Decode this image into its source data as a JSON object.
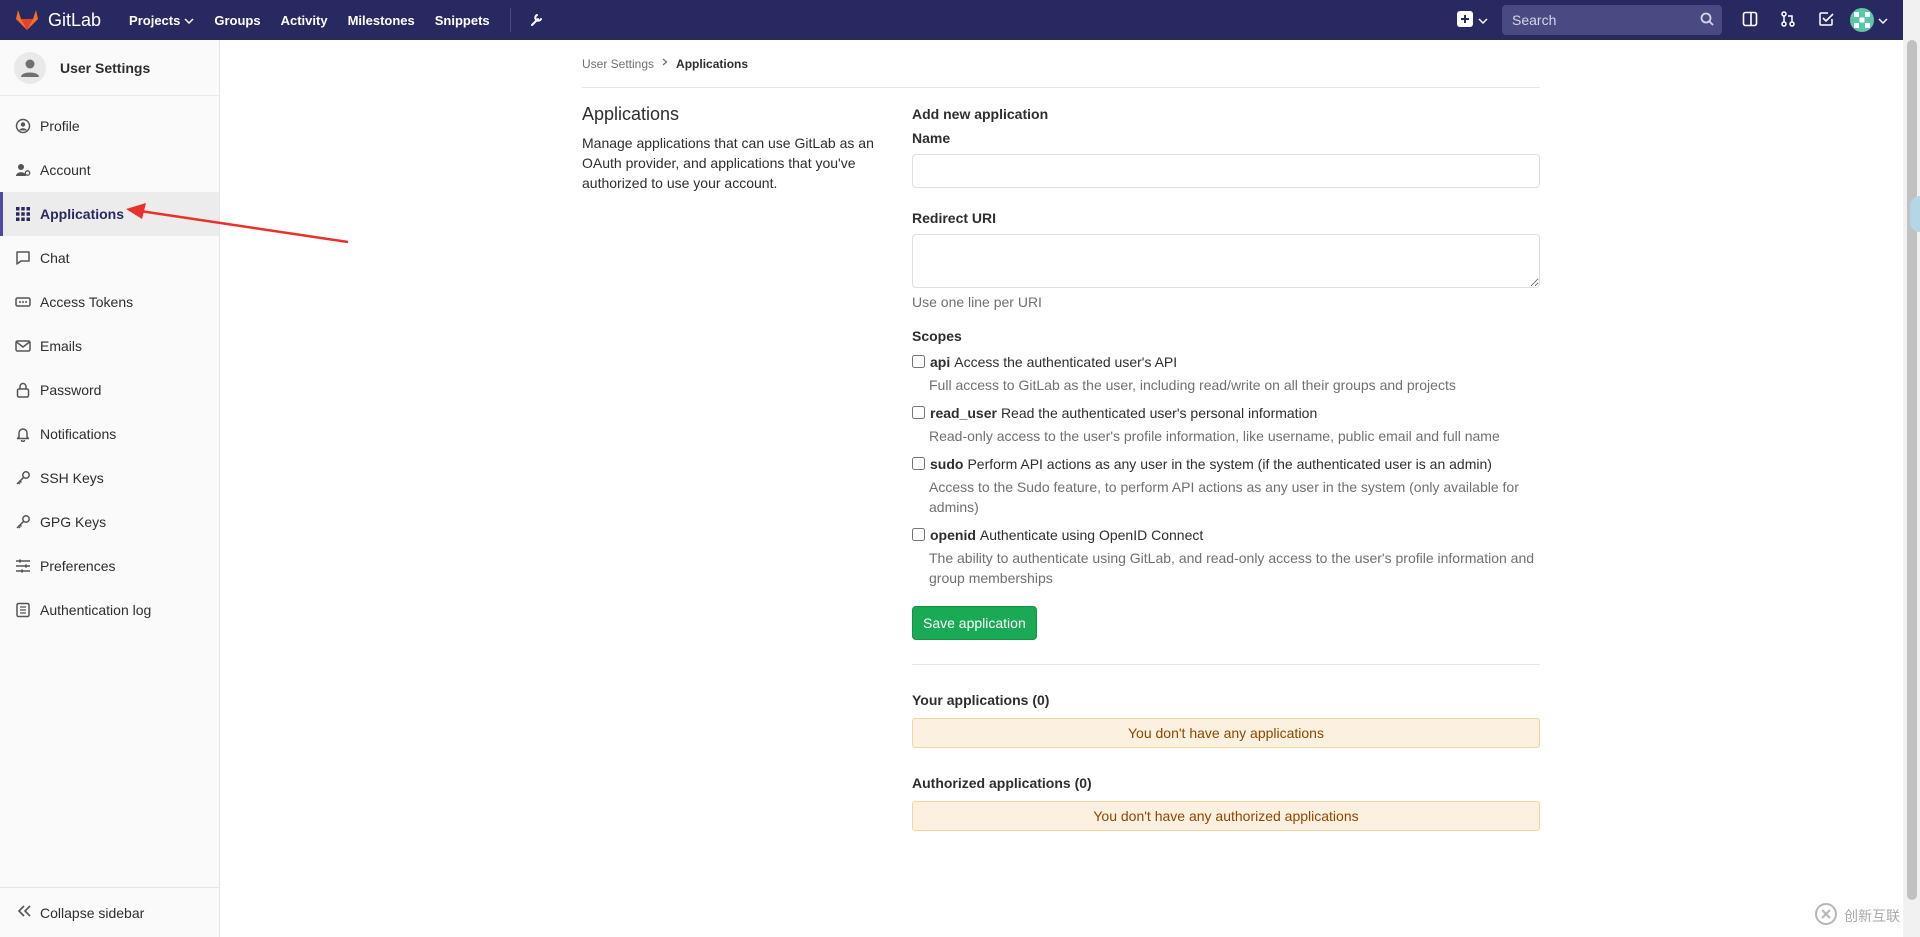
{
  "navbar": {
    "brand": "GitLab",
    "links": [
      {
        "label": "Projects",
        "has_caret": true
      },
      {
        "label": "Groups"
      },
      {
        "label": "Activity"
      },
      {
        "label": "Milestones"
      },
      {
        "label": "Snippets"
      }
    ],
    "search_placeholder": "Search"
  },
  "sidebar": {
    "title": "User Settings",
    "items": [
      {
        "label": "Profile",
        "icon": "profile-icon"
      },
      {
        "label": "Account",
        "icon": "account-icon"
      },
      {
        "label": "Applications",
        "icon": "applications-icon",
        "active": true
      },
      {
        "label": "Chat",
        "icon": "chat-icon"
      },
      {
        "label": "Access Tokens",
        "icon": "access-tokens-icon"
      },
      {
        "label": "Emails",
        "icon": "email-icon"
      },
      {
        "label": "Password",
        "icon": "lock-icon"
      },
      {
        "label": "Notifications",
        "icon": "bell-icon"
      },
      {
        "label": "SSH Keys",
        "icon": "key-icon"
      },
      {
        "label": "GPG Keys",
        "icon": "key-icon"
      },
      {
        "label": "Preferences",
        "icon": "preferences-icon"
      },
      {
        "label": "Authentication log",
        "icon": "log-icon"
      }
    ],
    "collapse_label": "Collapse sidebar"
  },
  "breadcrumb": {
    "parent": "User Settings",
    "current": "Applications"
  },
  "intro": {
    "title": "Applications",
    "description": "Manage applications that can use GitLab as an OAuth provider, and applications that you've authorized to use your account."
  },
  "form": {
    "heading": "Add new application",
    "name_label": "Name",
    "name_value": "",
    "redirect_label": "Redirect URI",
    "redirect_value": "",
    "redirect_help": "Use one line per URI",
    "scopes_label": "Scopes",
    "scopes": [
      {
        "name": "api",
        "summary": "Access the authenticated user's API",
        "description": "Full access to GitLab as the user, including read/write on all their groups and projects"
      },
      {
        "name": "read_user",
        "summary": "Read the authenticated user's personal information",
        "description": "Read-only access to the user's profile information, like username, public email and full name"
      },
      {
        "name": "sudo",
        "summary": "Perform API actions as any user in the system (if the authenticated user is an admin)",
        "description": "Access to the Sudo feature, to perform API actions as any user in the system (only available for admins)"
      },
      {
        "name": "openid",
        "summary": "Authenticate using OpenID Connect",
        "description": "The ability to authenticate using GitLab, and read-only access to the user's profile information and group memberships"
      }
    ],
    "save_label": "Save application"
  },
  "your_apps": {
    "title": "Your applications (0)",
    "empty": "You don't have any applications"
  },
  "authorized_apps": {
    "title": "Authorized applications (0)",
    "empty": "You don't have any authorized applications"
  },
  "watermark": {
    "text": "创新互联"
  },
  "colors": {
    "navbar": "#292961",
    "save_button": "#1aaa55",
    "warning_bg": "#fcf1e0",
    "warning_text": "#8f4700",
    "annotation_arrow": "#e8312b"
  }
}
